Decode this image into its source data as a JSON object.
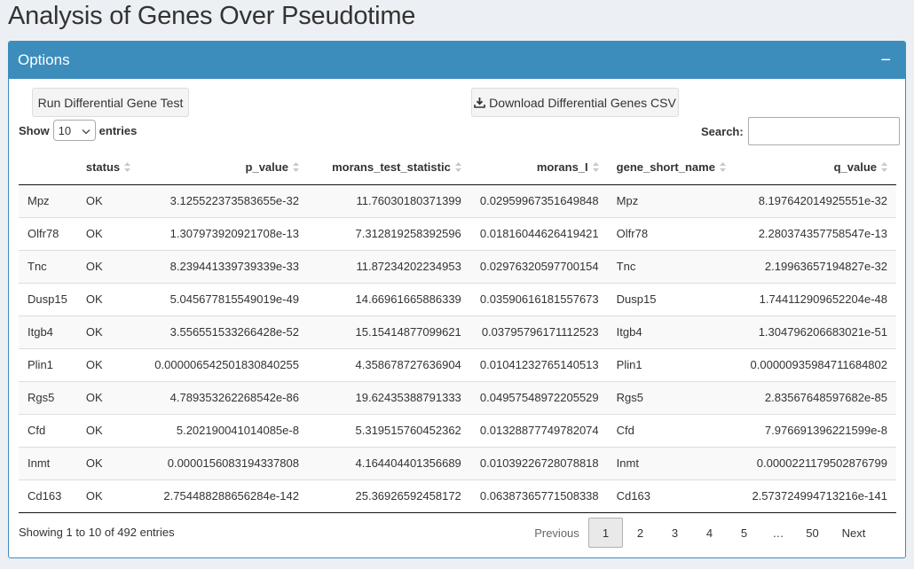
{
  "page": {
    "title": "Analysis of Genes Over Pseudotime"
  },
  "box": {
    "title": "Options",
    "collapse_symbol": "−"
  },
  "buttons": {
    "run_label": "Run Differential Gene Test",
    "download_label": "Download Differential Genes CSV",
    "download_icon": "download-icon"
  },
  "length": {
    "show_label": "Show",
    "entries_label": "entries",
    "selected": "10",
    "icon": "chevron-down-icon"
  },
  "search": {
    "label": "Search:",
    "value": "",
    "placeholder": ""
  },
  "table": {
    "columns": [
      "",
      "status",
      "p_value",
      "morans_test_statistic",
      "morans_I",
      "gene_short_name",
      "q_value"
    ],
    "rows": [
      [
        "Mpz",
        "OK",
        "3.125522373583655e-32",
        "11.76030180371399",
        "0.02959967351649848",
        "Mpz",
        "8.197642014925551e-32"
      ],
      [
        "Olfr78",
        "OK",
        "1.307973920921708e-13",
        "7.312819258392596",
        "0.01816044626419421",
        "Olfr78",
        "2.280374357758547e-13"
      ],
      [
        "Tnc",
        "OK",
        "8.239441339739339e-33",
        "11.87234202234953",
        "0.02976320597700154",
        "Tnc",
        "2.19963657194827e-32"
      ],
      [
        "Dusp15",
        "OK",
        "5.045677815549019e-49",
        "14.66961665886339",
        "0.03590616181557673",
        "Dusp15",
        "1.744112909652204e-48"
      ],
      [
        "Itgb4",
        "OK",
        "3.556551533266428e-52",
        "15.15414877099621",
        "0.03795796171112523",
        "Itgb4",
        "1.304796206683021e-51"
      ],
      [
        "Plin1",
        "OK",
        "0.000006542501830840255",
        "4.358678727636904",
        "0.01041232765140513",
        "Plin1",
        "0.00000935984711684802"
      ],
      [
        "Rgs5",
        "OK",
        "4.789353262268542e-86",
        "19.62435388791333",
        "0.04957548972205529",
        "Rgs5",
        "2.83567648597682e-85"
      ],
      [
        "Cfd",
        "OK",
        "5.202190041014085e-8",
        "5.319515760452362",
        "0.01328877749782074",
        "Cfd",
        "7.976691396221599e-8"
      ],
      [
        "Inmt",
        "OK",
        "0.0000156083194337808",
        "4.164404401356689",
        "0.01039226728078818",
        "Inmt",
        "0.0000221179502876799"
      ],
      [
        "Cd163",
        "OK",
        "2.754488288656284e-142",
        "25.36926592458172",
        "0.06387365771508338",
        "Cd163",
        "2.573724994713216e-141"
      ]
    ]
  },
  "info": "Showing 1 to 10 of 492 entries",
  "pagination": {
    "previous": "Previous",
    "pages": [
      "1",
      "2",
      "3",
      "4",
      "5"
    ],
    "ellipsis": "…",
    "last": "50",
    "next": "Next",
    "current": "1"
  }
}
